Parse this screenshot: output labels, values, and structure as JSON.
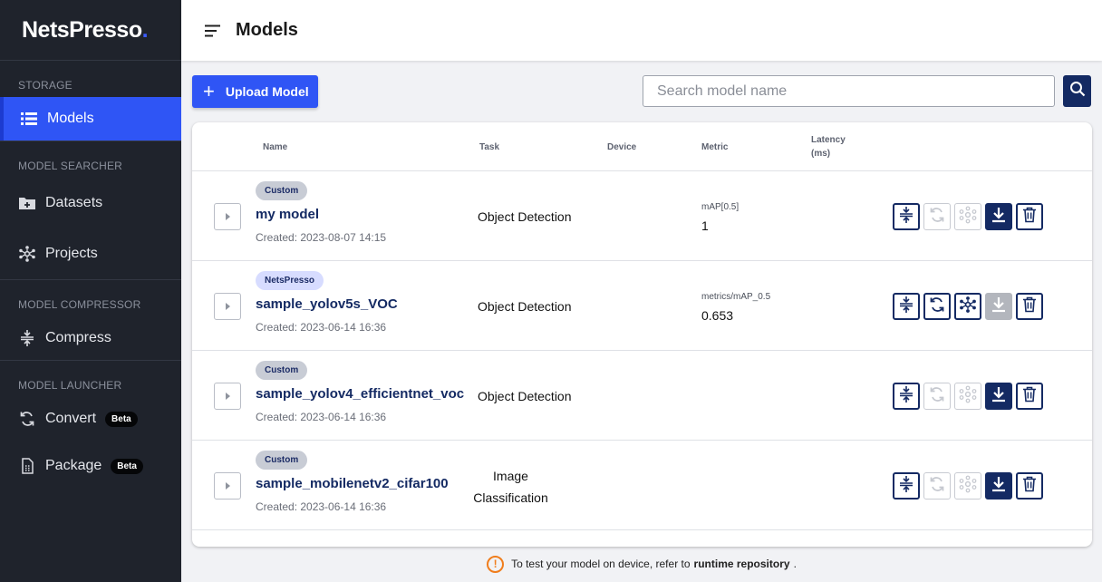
{
  "app": {
    "logo_text": "NetsPress",
    "logo_tail": "o",
    "logo_dot": "."
  },
  "sidebar": {
    "sections": [
      {
        "title": "STORAGE"
      },
      {
        "title": "MODEL SEARCHER"
      },
      {
        "title": "MODEL COMPRESSOR"
      },
      {
        "title": "MODEL LAUNCHER"
      }
    ],
    "items": [
      {
        "label": "Models",
        "icon": "list-icon",
        "active": true
      },
      {
        "label": "Datasets",
        "icon": "folder-add-icon"
      },
      {
        "label": "Projects",
        "icon": "network-icon"
      },
      {
        "label": "Compress",
        "icon": "compress-icon"
      },
      {
        "label": "Convert",
        "icon": "convert-icon",
        "badge": "Beta"
      },
      {
        "label": "Package",
        "icon": "package-icon",
        "badge": "Beta"
      }
    ]
  },
  "header": {
    "title": "Models"
  },
  "toolbar": {
    "upload_label": "Upload Model",
    "search_placeholder": "Search model name"
  },
  "table": {
    "columns": [
      "Name",
      "Task",
      "Device",
      "Metric",
      "Latency",
      "(ms)"
    ],
    "rows": [
      {
        "tag": "Custom",
        "name": "my model",
        "created": "Created: 2023-08-07 14:15",
        "task": "Object Detection",
        "metric_label": "mAP[0.5]",
        "metric_value": "1"
      },
      {
        "tag": "NetsPresso",
        "name": "sample_yolov5s_VOC",
        "created": "Created: 2023-06-14 16:36",
        "task": "Object Detection",
        "metric_label": "metrics/mAP_0.5",
        "metric_value": "0.653"
      },
      {
        "tag": "Custom",
        "name": "sample_yolov4_efficientnet_voc",
        "created": "Created: 2023-06-14 16:36",
        "task": "Object Detection",
        "metric_label": "",
        "metric_value": ""
      },
      {
        "tag": "Custom",
        "name": "sample_mobilenetv2_cifar100",
        "created": "Created: 2023-06-14 16:36",
        "task_line1": "Image",
        "task_line2": "Classification",
        "metric_label": "",
        "metric_value": ""
      }
    ]
  },
  "footer": {
    "text_before": "To test your model on device, refer to",
    "link": "runtime repository",
    "text_after": "."
  },
  "colors": {
    "accent": "#2f55f5",
    "navy": "#142a63",
    "sidebar": "#1f232c",
    "warning": "#f07d1c"
  }
}
